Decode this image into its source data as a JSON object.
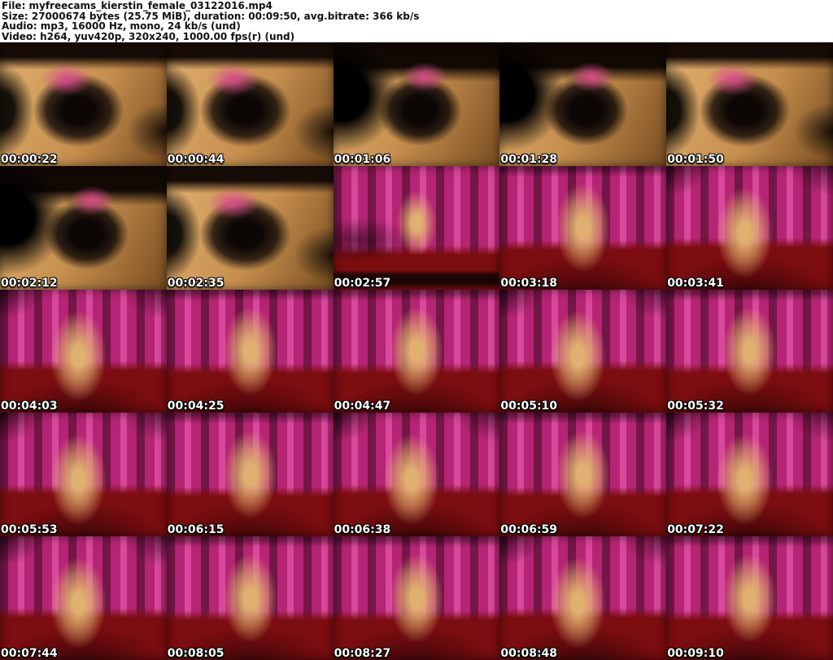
{
  "header": {
    "lines": [
      "File: myfreecams_kierstin_female_03122016.mp4",
      "Size: 27000674 bytes (25.75 MiB), duration: 00:09:50, avg.bitrate: 366 kb/s",
      "Audio: mp3, 16000 Hz, mono, 24 kb/s (und)",
      "Video: h264, yuv420p, 320x240, 1000.00 fps(r) (und)"
    ]
  },
  "palette": {
    "mag": "#b52573",
    "mag-l": "#d8489c",
    "mag-d": "#741647",
    "red": "#7c0d10",
    "warm": "#c68f4e",
    "warm-l": "#e0b070",
    "warm-d": "#7a4e22",
    "blk": "#0c0605",
    "pink": "#d94b8c"
  },
  "grid": {
    "columns": 5,
    "rows": 5,
    "tiles": [
      {
        "time": "00:00:22",
        "style": "closeup"
      },
      {
        "time": "00:00:44",
        "style": "closeup"
      },
      {
        "time": "00:01:06",
        "style": "closeup-b"
      },
      {
        "time": "00:01:28",
        "style": "closeup-b"
      },
      {
        "time": "00:01:50",
        "style": "closeup"
      },
      {
        "time": "00:02:12",
        "style": "closeup-b"
      },
      {
        "time": "00:02:35",
        "style": "closeup"
      },
      {
        "time": "00:02:57",
        "style": "curtain-wide"
      },
      {
        "time": "00:03:18",
        "style": "curtain"
      },
      {
        "time": "00:03:41",
        "style": "curtain-b"
      },
      {
        "time": "00:04:03",
        "style": "curtain-b"
      },
      {
        "time": "00:04:25",
        "style": "curtain"
      },
      {
        "time": "00:04:47",
        "style": "curtain"
      },
      {
        "time": "00:05:10",
        "style": "curtain-b"
      },
      {
        "time": "00:05:32",
        "style": "curtain"
      },
      {
        "time": "00:05:53",
        "style": "curtain-b"
      },
      {
        "time": "00:06:15",
        "style": "curtain"
      },
      {
        "time": "00:06:38",
        "style": "curtain-b"
      },
      {
        "time": "00:06:59",
        "style": "curtain"
      },
      {
        "time": "00:07:22",
        "style": "curtain-b"
      },
      {
        "time": "00:07:44",
        "style": "curtain-b"
      },
      {
        "time": "00:08:05",
        "style": "curtain"
      },
      {
        "time": "00:08:27",
        "style": "curtain"
      },
      {
        "time": "00:08:48",
        "style": "curtain-b"
      },
      {
        "time": "00:09:10",
        "style": "curtain"
      }
    ]
  }
}
